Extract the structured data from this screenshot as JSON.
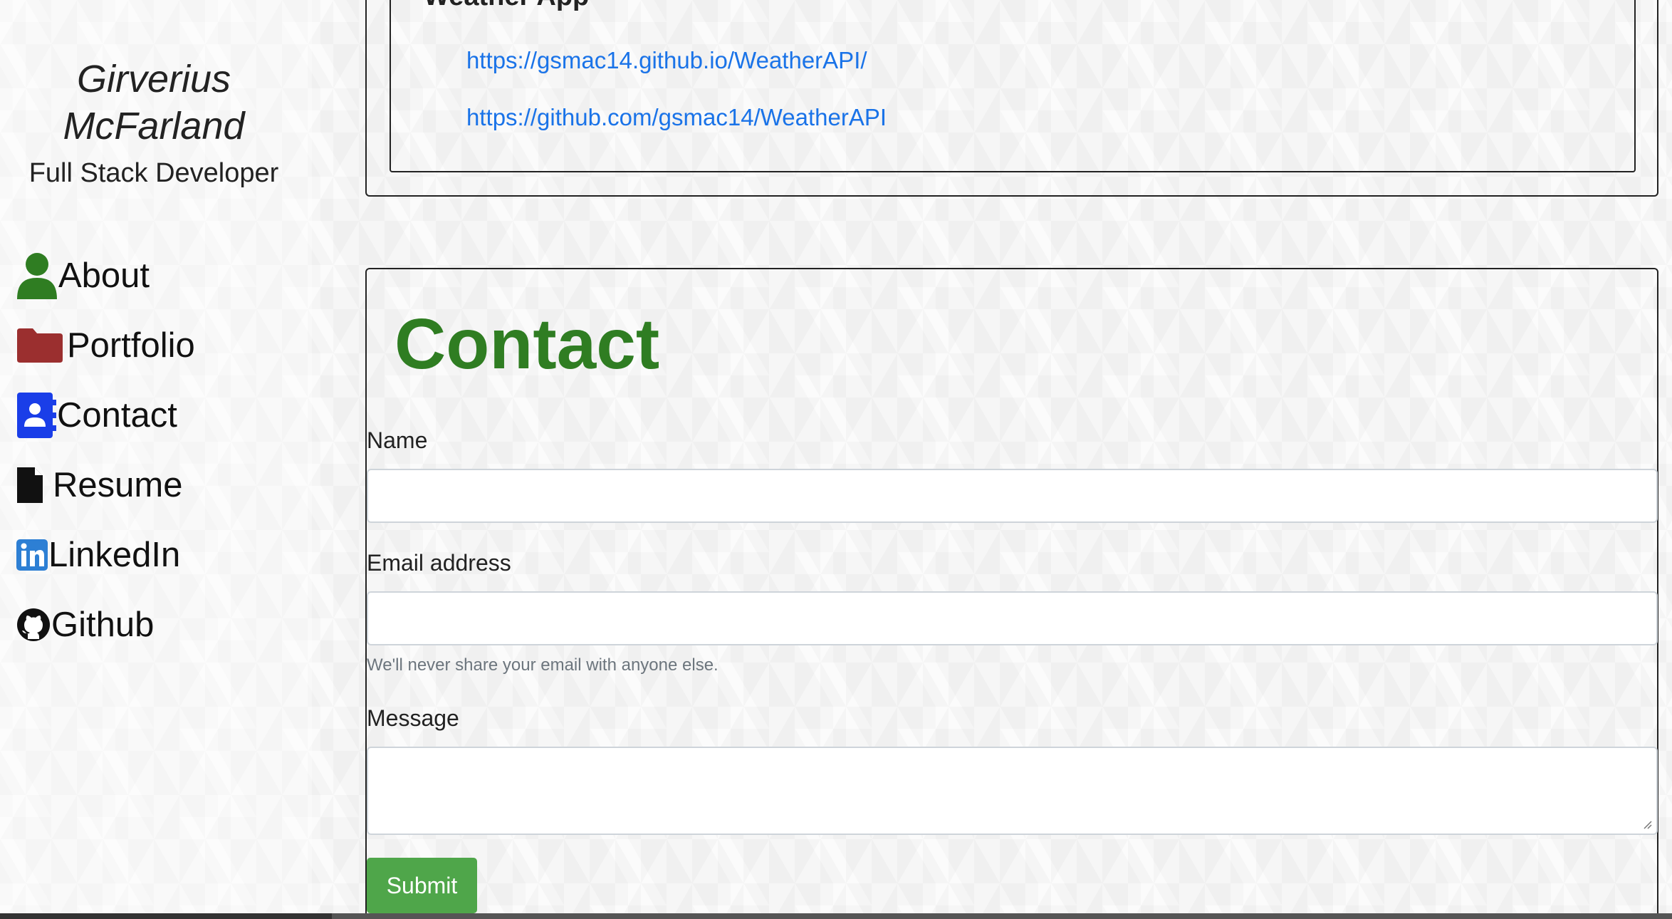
{
  "profile": {
    "name": "Girverius McFarland",
    "role": "Full Stack Developer"
  },
  "nav": [
    {
      "label": "About",
      "icon": "person-icon",
      "color": "#2f7d22"
    },
    {
      "label": "Portfolio",
      "icon": "folder-icon",
      "color": "#9b2f2f"
    },
    {
      "label": "Contact",
      "icon": "contact-card-icon",
      "color": "#1a3ee8"
    },
    {
      "label": "Resume",
      "icon": "file-icon",
      "color": "#111111"
    },
    {
      "label": "LinkedIn",
      "icon": "linkedin-icon",
      "color": "#2d7fd4"
    },
    {
      "label": "Github",
      "icon": "github-icon",
      "color": "#111111"
    }
  ],
  "project": {
    "title": "Weather App",
    "links": [
      "https://gsmac14.github.io/WeatherAPI/",
      "https://github.com/gsmac14/WeatherAPI"
    ]
  },
  "contact": {
    "title": "Contact",
    "name_label": "Name",
    "name_value": "",
    "email_label": "Email address",
    "email_value": "",
    "email_hint": "We'll never share your email with anyone else.",
    "message_label": "Message",
    "message_value": "",
    "submit_label": "Submit"
  },
  "colors": {
    "accent": "#2f7d22",
    "link": "#1a73e8",
    "button": "#4fa64a"
  }
}
